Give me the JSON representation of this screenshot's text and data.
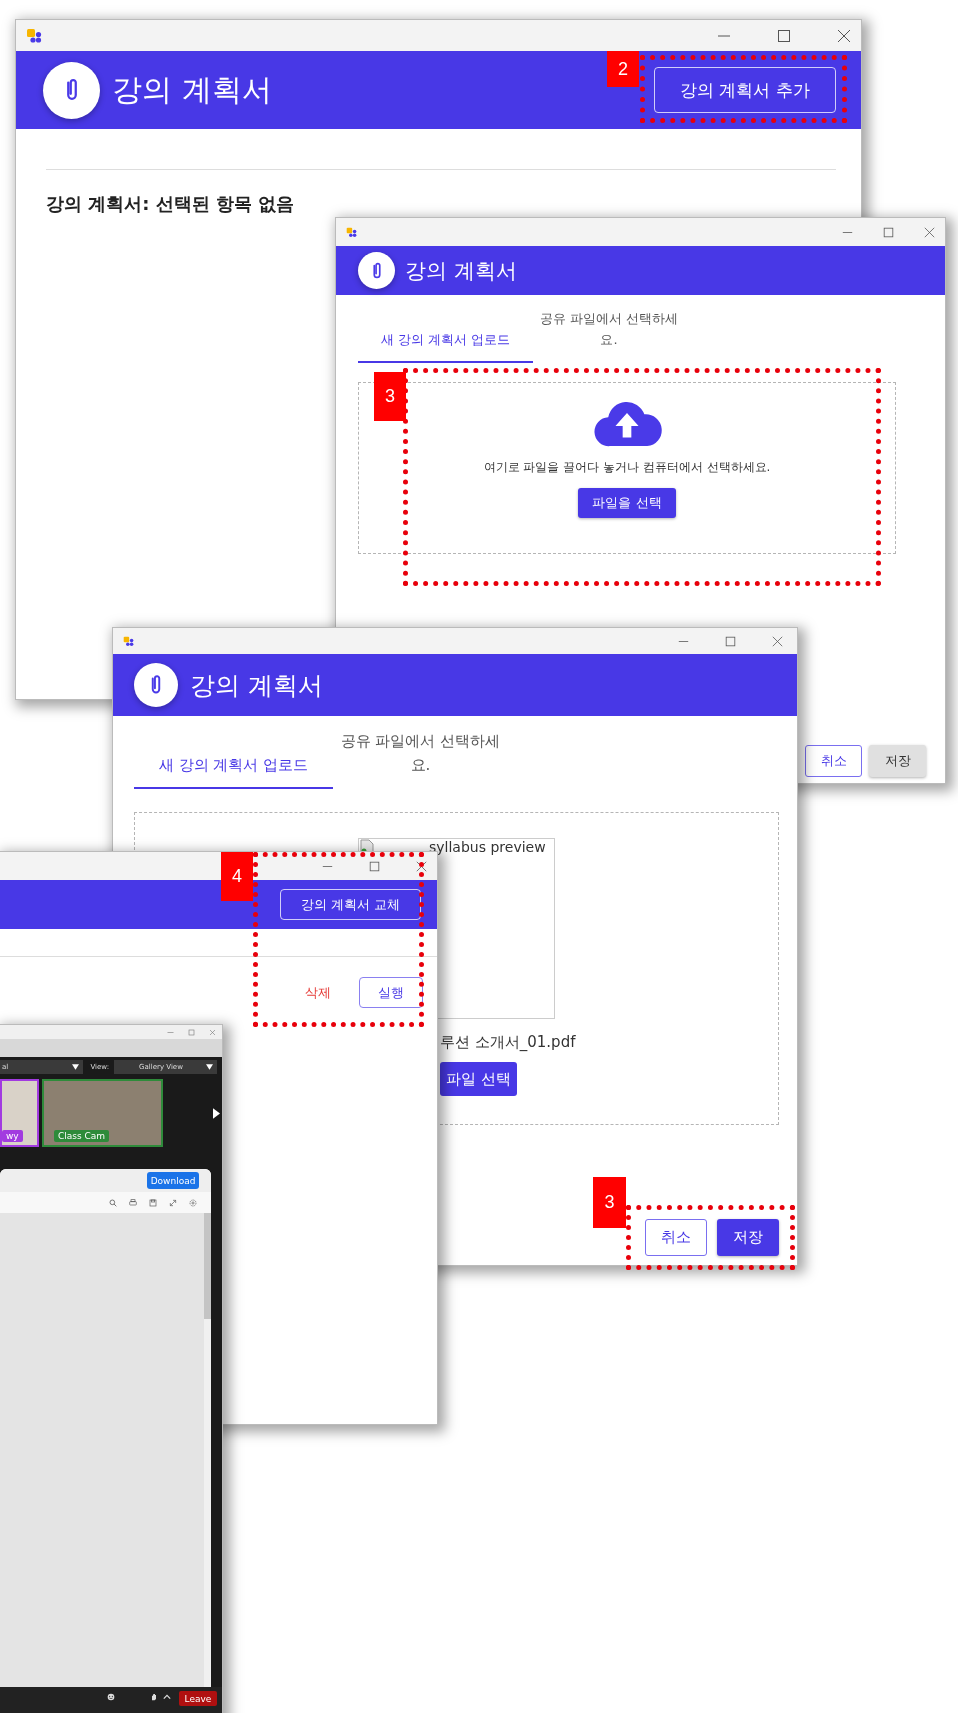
{
  "main_window": {
    "title": "강의 계획서",
    "add_button": "강의 계획서 추가",
    "status": "강의 계획서: 선택된 항목 없음"
  },
  "upload_window": {
    "title": "강의 계획서",
    "tabs": [
      {
        "label": "새 강의 계획서 업로드",
        "selected": true
      },
      {
        "label": "공유 파일에서 선택하세요.",
        "selected": false
      }
    ],
    "drop_text": "여기로 파일을 끌어다 놓거나 컴퓨터에서 선택하세요.",
    "choose_button": "파일을 선택",
    "buttons": [
      {
        "label": "취소",
        "kind": "outline",
        "disabled": false
      },
      {
        "label": "저장",
        "kind": "filled",
        "disabled": true
      }
    ]
  },
  "preview_window": {
    "title": "강의 계획서",
    "tabs": [
      {
        "label": "새 강의 계획서 업로드",
        "selected": true
      },
      {
        "label": "공유 파일에서 선택하세요.",
        "selected": false
      }
    ],
    "preview_alt": "syllabus preview",
    "file_name": "루션 소개서_01.pdf",
    "choose_button": "파일 선택",
    "buttons": [
      {
        "label": "취소",
        "kind": "outline",
        "disabled": false
      },
      {
        "label": "저장",
        "kind": "filled",
        "disabled": false
      }
    ]
  },
  "replace_window": {
    "replace_button": "강의 계획서 교체",
    "delete_button": "삭제",
    "run_button": "실행"
  },
  "meeting_window": {
    "channel_select": "al",
    "view_label": "View:",
    "view_select": "Gallery View",
    "tiles": [
      {
        "name": "wy",
        "color": "#a23be0"
      },
      {
        "name": "Class Cam",
        "color": "#2e8b3a"
      }
    ],
    "download_button": "Download",
    "leave_button": "Leave"
  },
  "annotations": [
    {
      "label": "2"
    },
    {
      "label": "3"
    },
    {
      "label": "4"
    },
    {
      "label": "3"
    }
  ]
}
